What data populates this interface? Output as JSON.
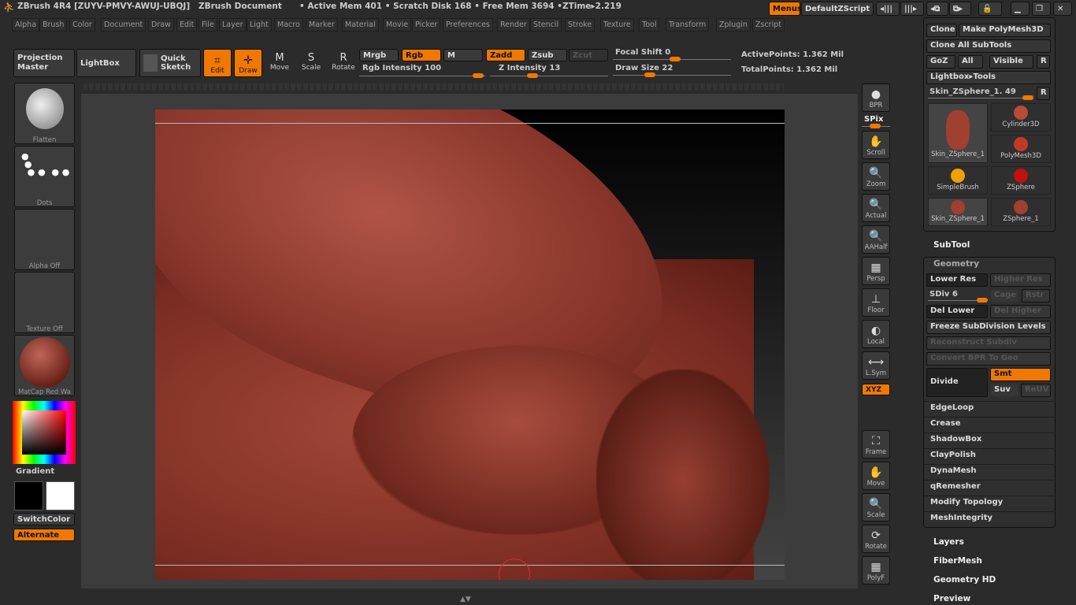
{
  "titlebar": {
    "app": "ZBrush 4R4 [ZUYV-PMVY-AWUJ-UBQJ]",
    "doc": "ZBrush Document",
    "mem": "• Active Mem 401 • Scratch Disk 168 • Free Mem 3694 •ZTime▸2.219",
    "menus": "Menus",
    "script": "DefaultZScript"
  },
  "menu": [
    "Alpha",
    "Brush",
    "Color",
    "Document",
    "Draw",
    "Edit",
    "File",
    "Layer",
    "Light",
    "Macro",
    "Marker",
    "Material",
    "Movie",
    "Picker",
    "Preferences",
    "Render",
    "Stencil",
    "Stroke",
    "Texture",
    "Tool",
    "Transform",
    "Zplugin",
    "Zscript"
  ],
  "toolbar": {
    "projection": "Projection Master",
    "lightbox": "LightBox",
    "quick": "Quick Sketch",
    "edit": "Edit",
    "draw": "Draw",
    "move": "Move",
    "scale": "Scale",
    "rotate": "Rotate",
    "mrgb": "Mrgb",
    "rgb": "Rgb",
    "m": "M",
    "zadd": "Zadd",
    "zsub": "Zsub",
    "zcut": "Zcut",
    "rgb_int": "Rgb Intensity 100",
    "z_int": "Z Intensity 13",
    "focal": "Focal Shift 0",
    "draw_size": "Draw Size 22",
    "active": "ActivePoints: 1.362 Mil",
    "total": "TotalPoints: 1.362 Mil",
    "rgb_int_val": 100,
    "z_int_val": 13,
    "focal_val": 0,
    "draw_size_val": 22
  },
  "left": {
    "flatten": "Flatten",
    "dots": "Dots",
    "alpha": "Alpha Off",
    "texture": "Texture Off",
    "matcap": "MatCap Red Wa",
    "gradient": "Gradient",
    "switch": "SwitchColor",
    "alternate": "Alternate"
  },
  "righttools": [
    "BPR",
    "SPix",
    "Scroll",
    "Zoom",
    "Actual",
    "AAHalf",
    "Persp",
    "Floor",
    "Local",
    "L.Sym",
    "XYZ",
    "Frame",
    "Move",
    "Scale",
    "Rotate",
    "PolyF"
  ],
  "tool": {
    "clone": "Clone",
    "make": "Make PolyMesh3D",
    "cloneall": "Clone All SubTools",
    "goz": "GoZ",
    "all": "All",
    "visible": "Visible",
    "r": "R",
    "lightbox": "Lightbox▸Tools",
    "skin": "Skin_ZSphere_1. 49",
    "thumbs": [
      "Skin_ZSphere_1",
      "Cylinder3D",
      "PolyMesh3D",
      "SimpleBrush",
      "ZSphere",
      "Skin_ZSphere_1",
      "ZSphere_1"
    ],
    "subtool": "SubTool",
    "geometry": "Geometry",
    "lower": "Lower Res",
    "higher": "Higher Res",
    "sdiv": "SDiv 6",
    "cage": "Cage",
    "rstr": "Rstr",
    "dellower": "Del Lower",
    "delhigher": "Del Higher",
    "freeze": "Freeze SubDivision Levels",
    "reconstruct": "Reconstruct Subdiv",
    "convert": "Convert BPR To Geo",
    "divide": "Divide",
    "smt": "Smt",
    "suv": "Suv",
    "reuv": "ReUV",
    "items": [
      "EdgeLoop",
      "Crease",
      "ShadowBox",
      "ClayPolish",
      "DynaMesh",
      "qRemesher",
      "Modify Topology",
      "MeshIntegrity"
    ],
    "sections": [
      "Layers",
      "FiberMesh",
      "Geometry HD",
      "Preview"
    ]
  },
  "colors": {
    "accent": "#f07800",
    "clay": "#9a3e30"
  }
}
